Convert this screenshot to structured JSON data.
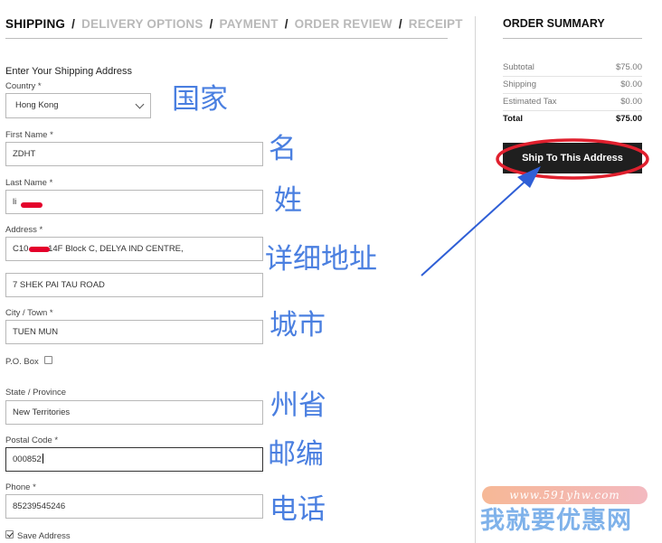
{
  "steps": {
    "shipping": "SHIPPING",
    "delivery": "DELIVERY OPTIONS",
    "payment": "PAYMENT",
    "review": "ORDER REVIEW",
    "receipt": "RECEIPT",
    "separator": "/"
  },
  "form": {
    "title": "Enter Your Shipping Address",
    "country": {
      "label": "Country *",
      "value": "Hong Kong"
    },
    "first_name": {
      "label": "First Name *",
      "value": "ZDHT"
    },
    "last_name": {
      "label": "Last Name *",
      "value": "li"
    },
    "address": {
      "label": "Address *",
      "line1_prefix": "C10",
      "line1_suffix": " 14F Block C, DELYA IND CENTRE,",
      "line2": "7 SHEK PAI TAU ROAD"
    },
    "city": {
      "label": "City / Town *",
      "value": "TUEN MUN"
    },
    "po_box": {
      "label": "P.O. Box"
    },
    "state": {
      "label": "State / Province",
      "value": "New Territories"
    },
    "postal": {
      "label": "Postal Code *",
      "value": "000852"
    },
    "phone": {
      "label": "Phone *",
      "value": "85239545246"
    },
    "save_address": {
      "label": "Save Address",
      "checked": true
    }
  },
  "annotations": {
    "country": "国家",
    "first_name": "名",
    "last_name": "姓",
    "address": "详细地址",
    "city": "城市",
    "state": "州省",
    "postal": "邮编",
    "phone": "电话",
    "color": "#4a7fe0",
    "highlight_color": "#e0202e"
  },
  "summary": {
    "title": "ORDER SUMMARY",
    "rows": [
      {
        "label": "Subtotal",
        "value": "$75.00"
      },
      {
        "label": "Shipping",
        "value": "$0.00"
      },
      {
        "label": "Estimated Tax",
        "value": "$0.00"
      },
      {
        "label": "Total",
        "value": "$75.00"
      }
    ],
    "button": "Ship To This Address"
  },
  "watermark": {
    "url": "www.591yhw.com",
    "text": "我就要优惠网"
  },
  "colors": {
    "accent_dark": "#1f1f1f",
    "inactive_step": "#b9b9b9",
    "redaction": "#e4002b"
  }
}
